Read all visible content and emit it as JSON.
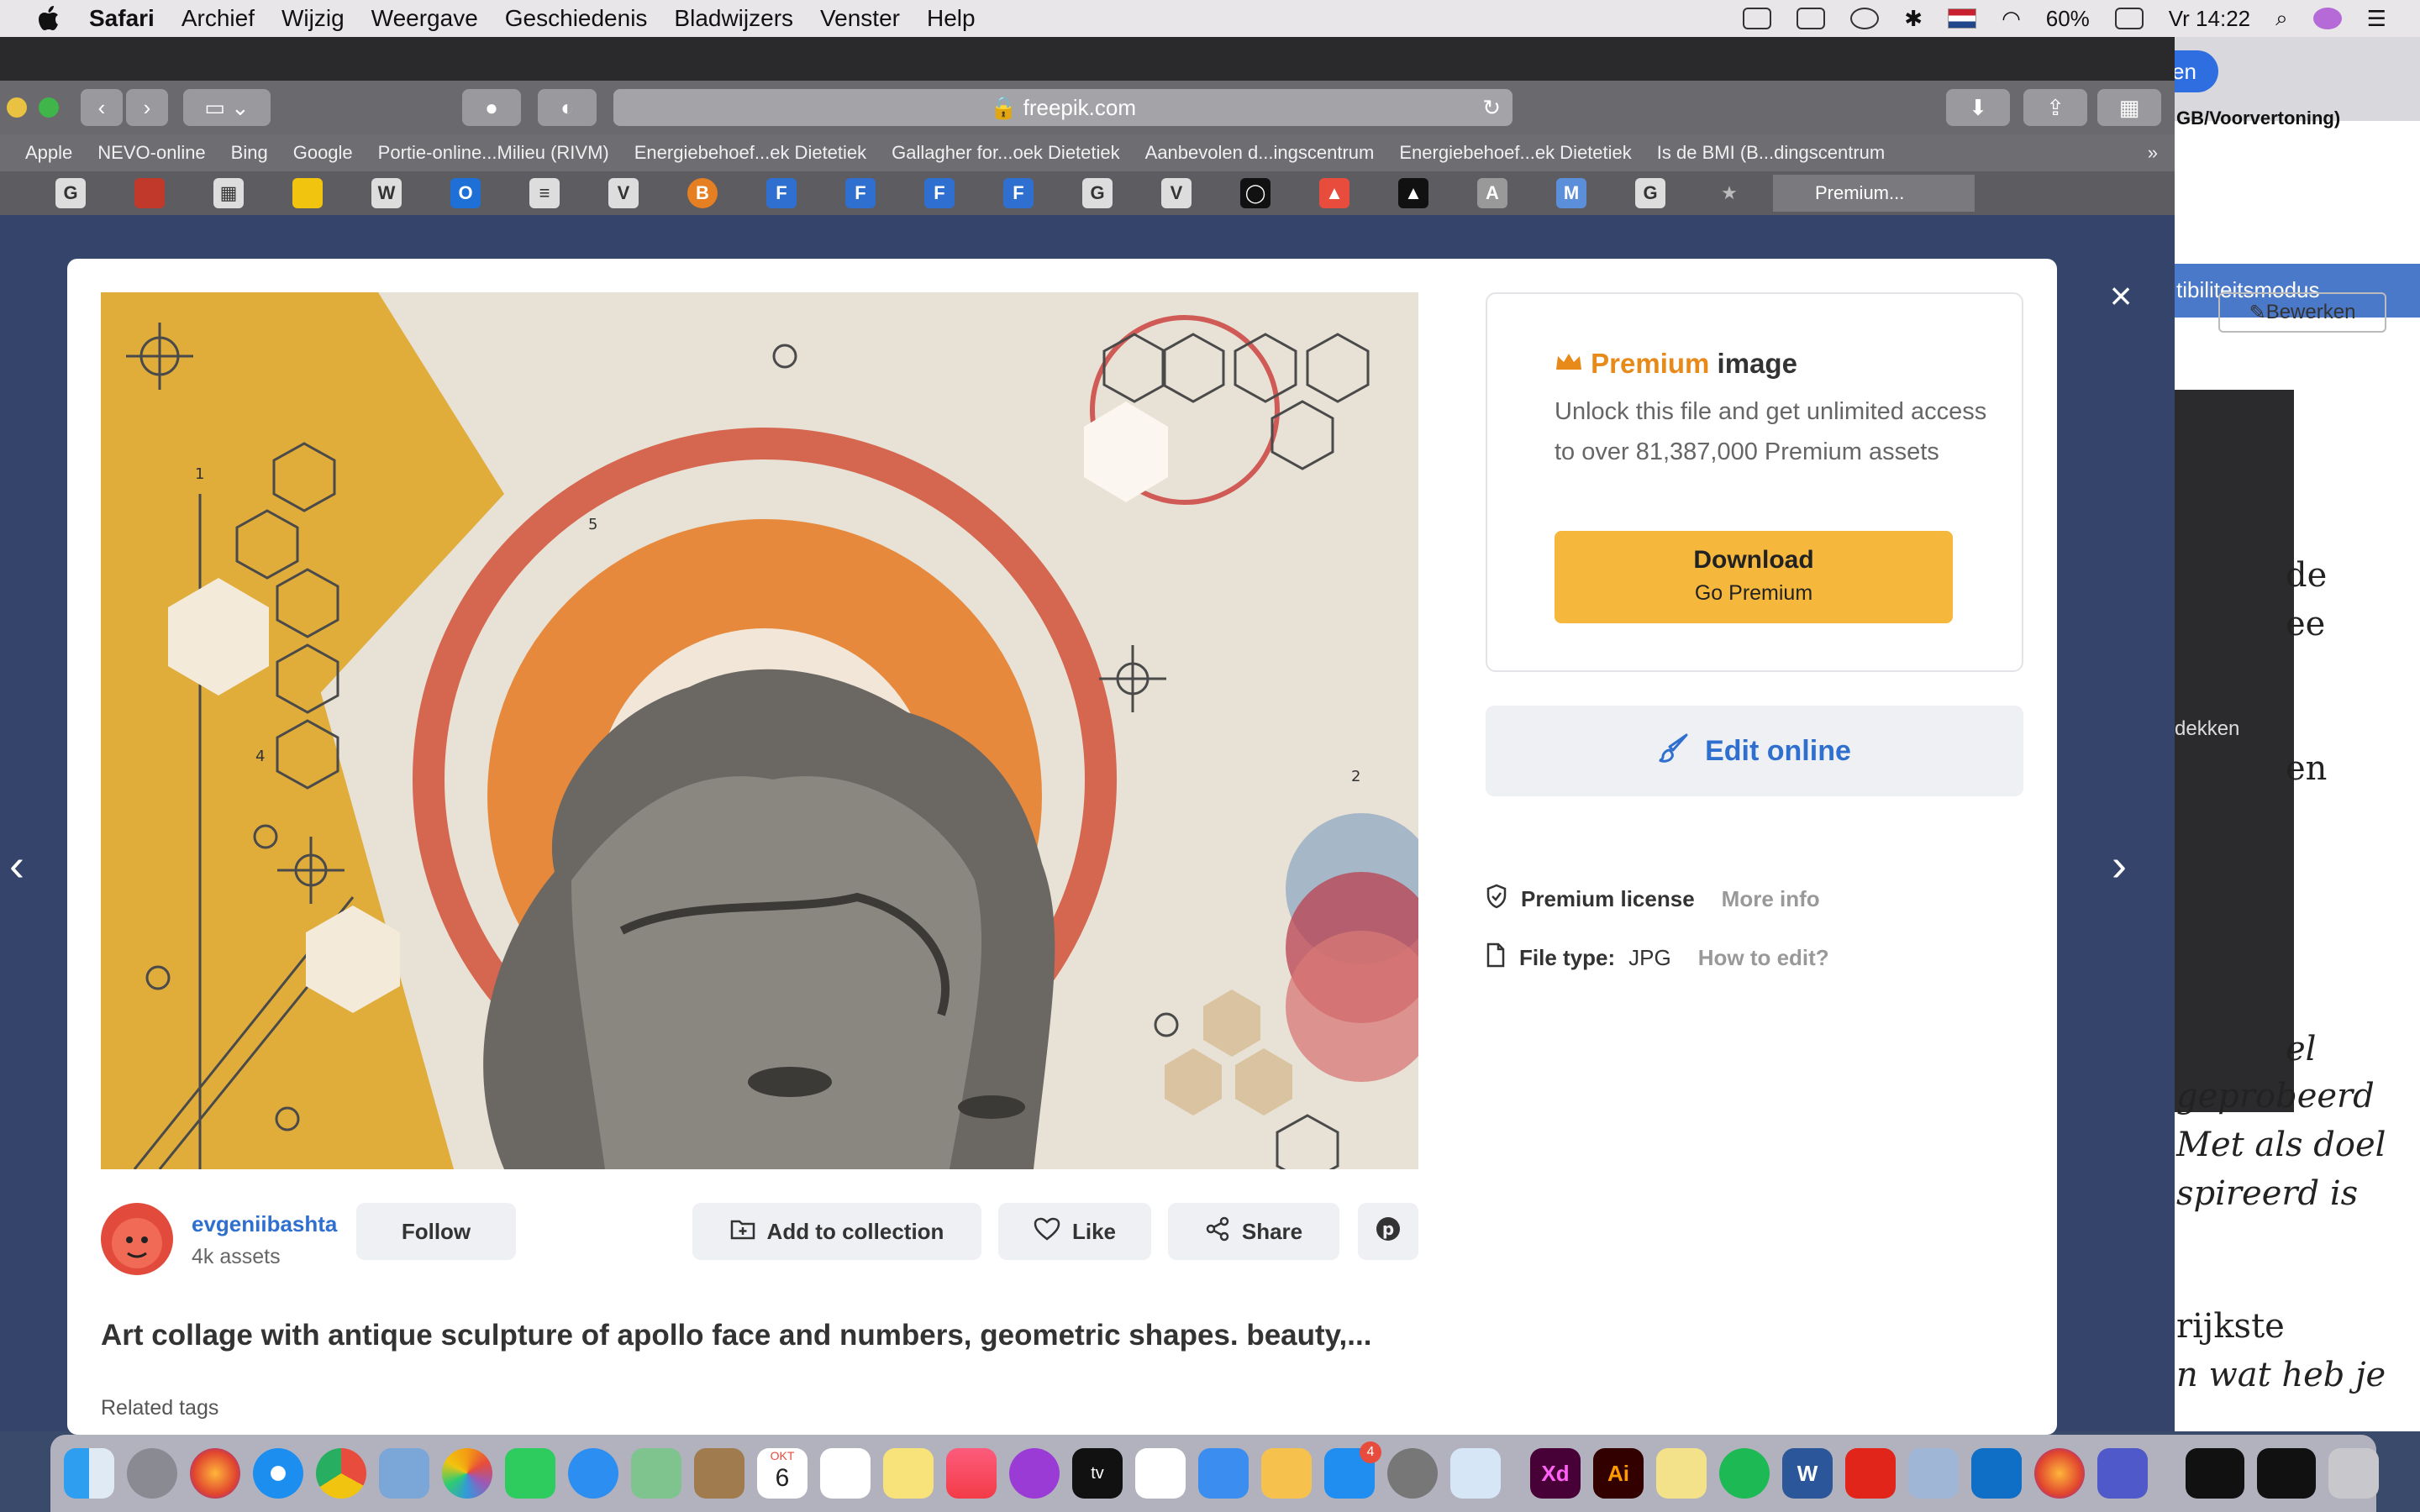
{
  "menubar": {
    "app": "Safari",
    "items": [
      "Archief",
      "Wijzig",
      "Weergave",
      "Geschiedenis",
      "Bladwijzers",
      "Venster",
      "Help"
    ],
    "battery": "60%",
    "clock": "Vr 14:22"
  },
  "safari": {
    "url": "freepik.com",
    "favorites": [
      "Apple",
      "NEVO-online",
      "Bing",
      "Google",
      "Portie-online...Milieu (RIVM)",
      "Energiebehoef...ek Dietetiek",
      "Gallagher for...oek Dietetiek",
      "Aanbevolen d...ingscentrum",
      "Energiebehoef...ek Dietetiek",
      "Is de BMI (B...dingscentrum"
    ],
    "active_tab": "Premium..."
  },
  "background_window": {
    "share_button": "Delen",
    "title_fragment": "GB/Voorvertoning)",
    "compat_mode": "tibiliteitsmodus",
    "edit_button": "Bewerken",
    "side_text": "dekken",
    "doc_lines": [
      "de",
      "ee",
      "en",
      "el",
      "geprobeerd",
      "Met als doel",
      "spireerd is",
      "rijkste",
      "n wat heb je"
    ]
  },
  "image": {
    "numbers": [
      "1",
      "5",
      "4",
      "2"
    ]
  },
  "author": {
    "name": "evgeniibashta",
    "assets": "4k assets",
    "follow": "Follow"
  },
  "actions": {
    "add_to_collection": "Add to collection",
    "like": "Like",
    "share": "Share"
  },
  "asset": {
    "title": "Art collage with antique sculpture of apollo face and numbers, geometric shapes. beauty,...",
    "related_tags": "Related tags"
  },
  "premium": {
    "title_accent": "Premium",
    "title_rest": " image",
    "description": "Unlock this file and get unlimited access to over 81,387,000 Premium assets",
    "download_label": "Download",
    "download_sub": "Go Premium",
    "edit_online": "Edit online",
    "license_label": "Premium license",
    "license_more": "More info",
    "file_type_label": "File type:",
    "file_type_value": "JPG",
    "how_to_edit": "How to edit?"
  },
  "dock": {
    "calendar_month": "OKT",
    "calendar_day": "6",
    "appstore_badge": "4"
  },
  "colors": {
    "accent_blue": "#2f6fcf",
    "premium_orange": "#e88a1a",
    "download_yellow": "#f5b83d"
  }
}
